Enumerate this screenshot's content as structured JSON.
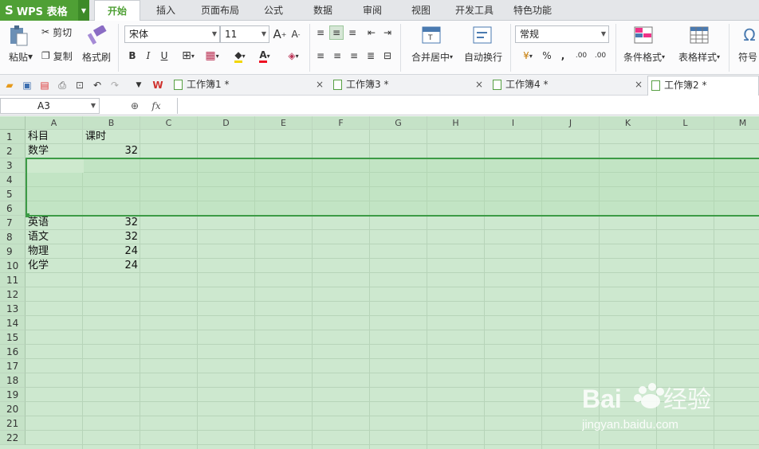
{
  "app": {
    "logo_text": "WPS 表格",
    "logo_icon": "S"
  },
  "menu": [
    "开始",
    "插入",
    "页面布局",
    "公式",
    "数据",
    "审阅",
    "视图",
    "开发工具",
    "特色功能"
  ],
  "ribbon": {
    "paste": "粘贴",
    "cut": "剪切",
    "copy": "复制",
    "format_painter": "格式刷",
    "font_name": "宋体",
    "font_size": "11",
    "bold": "B",
    "italic": "I",
    "underline": "U",
    "font_color_letter": "A",
    "merge_center": "合并居中",
    "wrap_text": "自动换行",
    "number_format": "常规",
    "percent": "%",
    "comma": ",",
    "inc_dec": ".00",
    "dec_dec": ".00",
    "cond_format": "条件格式",
    "table_style": "表格样式",
    "symbol": "符号"
  },
  "doc_tabs": [
    {
      "label": "工作簿1 *"
    },
    {
      "label": "工作簿3 *"
    },
    {
      "label": "工作簿4 *"
    },
    {
      "label": "工作簿2 *"
    }
  ],
  "formula_bar": {
    "name_box": "A3",
    "fx": "fx",
    "formula": ""
  },
  "columns": [
    "A",
    "B",
    "C",
    "D",
    "E",
    "F",
    "G",
    "H",
    "I",
    "J",
    "K",
    "L",
    "M"
  ],
  "rows": [
    "1",
    "2",
    "3",
    "4",
    "5",
    "6",
    "7",
    "8",
    "9",
    "10",
    "11",
    "12",
    "13",
    "14",
    "15",
    "16",
    "17",
    "18",
    "19",
    "20",
    "21",
    "22"
  ],
  "cells": {
    "A1": "科目",
    "B1": "课时",
    "A2": "数学",
    "B2": "32",
    "A7": "英语",
    "B7": "32",
    "A8": "语文",
    "B8": "32",
    "A9": "物理",
    "B9": "24",
    "A10": "化学",
    "B10": "24"
  },
  "selection": "A3:M6",
  "watermark": {
    "text": "Baidu 经验",
    "url": "jingyan.baidu.com"
  },
  "colors": {
    "accent": "#4fa035",
    "grid_bg": "#cde8cf",
    "selection_border": "#3c9b46"
  }
}
